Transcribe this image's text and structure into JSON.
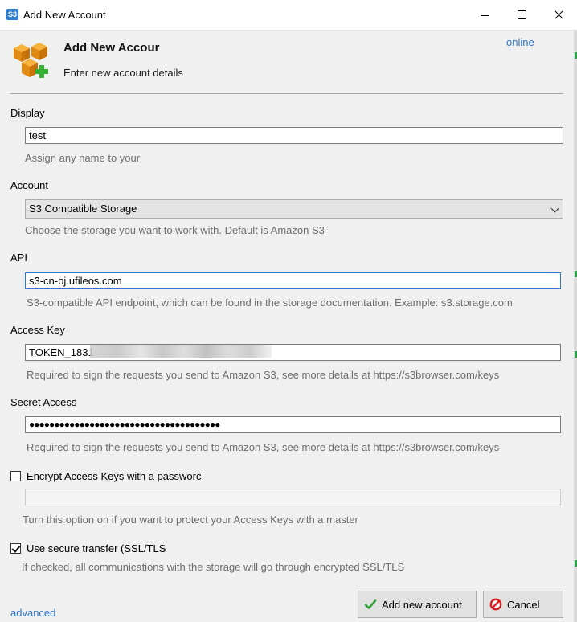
{
  "window": {
    "title": "Add New Account",
    "icon_text": "S3"
  },
  "header": {
    "title": "Add New Accour",
    "subtitle": "Enter new account details",
    "online_link": "online"
  },
  "display": {
    "label": "Display",
    "value": "test",
    "hint": "Assign any name to your"
  },
  "account": {
    "label": "Account",
    "selected": "S3 Compatible Storage",
    "hint": "Choose the storage you want to work with. Default is Amazon S3"
  },
  "api": {
    "label": "API",
    "value": "s3-cn-bj.ufileos.com",
    "hint": "S3-compatible API endpoint, which can be found in the storage documentation. Example: s3.storage.com"
  },
  "access_key": {
    "label": "Access Key",
    "value": "TOKEN_1831",
    "hint": "Required to sign the requests you send to Amazon S3, see more details at https://s3browser.com/keys"
  },
  "secret_access": {
    "label": "Secret Access",
    "value": "●●●●●●●●●●●●●●●●●●●●●●●●●●●●●●●●●●●●●●",
    "hint": "Required to sign the requests you send to Amazon S3, see more details at https://s3browser.com/keys"
  },
  "encrypt": {
    "label": "Encrypt Access Keys with a passworc",
    "checked": false,
    "password_value": "",
    "hint": "Turn this option on if you want to protect your Access Keys with a master"
  },
  "secure": {
    "label": "Use secure transfer (SSL/TLS",
    "checked": true,
    "hint": "If checked, all communications with the storage will go through encrypted SSL/TLS"
  },
  "footer": {
    "advanced_link": "advanced",
    "add_button": "Add new account",
    "cancel_button": "Cancel"
  },
  "colors": {
    "link": "#2e75c7",
    "focus_border": "#2b79d1",
    "hint_text": "#6d6d6d",
    "add_icon": "#2e9e3a",
    "cancel_icon": "#d42020"
  },
  "icons": {
    "app": "s3-app-icon",
    "header": "aws-box-add-icon",
    "add": "checkmark-icon",
    "cancel": "forbidden-icon"
  }
}
